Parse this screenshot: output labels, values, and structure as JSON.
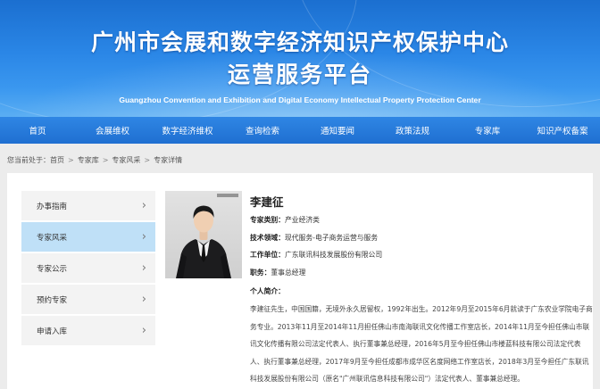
{
  "header": {
    "title_line1": "广州市会展和数字经济知识产权保护中心",
    "title_line2": "运营服务平台",
    "subtitle_en": "Guangzhou Convention and Exhibition and Digital Economy Intellectual Property Protection Center"
  },
  "nav": {
    "items": [
      "首页",
      "会展维权",
      "数字经济维权",
      "查询检索",
      "通知要闻",
      "政策法规",
      "专家库",
      "知识产权备案"
    ]
  },
  "breadcrumb": {
    "prefix": "您当前处于：",
    "items": [
      "首页",
      "专家库",
      "专家风采",
      "专家详情"
    ]
  },
  "sidebar": {
    "items": [
      {
        "label": "办事指南",
        "active": false
      },
      {
        "label": "专家风采",
        "active": true
      },
      {
        "label": "专家公示",
        "active": false
      },
      {
        "label": "预约专家",
        "active": false
      },
      {
        "label": "申请入库",
        "active": false
      }
    ]
  },
  "expert": {
    "name": "李建征",
    "category_label": "专家类别：",
    "category": "产业经济类",
    "field_label": "技术领域：",
    "field": "现代服务-电子商务运营与服务",
    "unit_label": "工作单位：",
    "unit": "广东联讯科技发展股份有限公司",
    "position_label": "职务：",
    "position": "董事总经理",
    "bio_label": "个人简介：",
    "bio": "李建征先生，中国国籍，无境外永久居留权，1992年出生。2012年9月至2015年6月就读于广东农业学院电子商务专业。2013年11月至2014年11月担任佛山市南海联讯文化传播工作室店长，2014年11月至今担任佛山市联讯文化传播有限公司法定代表人、执行董事兼总经理，2016年5月至今担任佛山市楼蓝科技有限公司法定代表人、执行董事兼总经理，2017年9月至今担任成都市成华区名度网络工作室店长，2018年3月至今担任广东联讯科技发展股份有限公司（原名\"广州联讯信息科技有限公司\"）法定代表人、董事兼总经理。"
  },
  "colors": {
    "banner_top": "#1b6fd0",
    "nav_bg": "#1f6fd1",
    "sidebar_active": "#bfe0f7",
    "sidebar_bg": "#f3f3f3"
  }
}
